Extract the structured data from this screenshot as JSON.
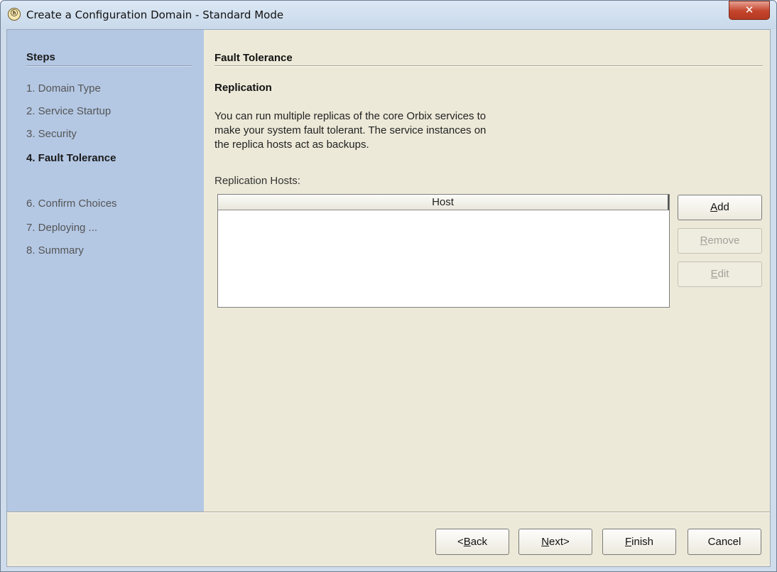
{
  "window": {
    "title": "Create a Configuration Domain - Standard Mode",
    "app_icon_glyph": "ⓗ",
    "close_glyph": "✕"
  },
  "sidebar": {
    "title": "Steps",
    "items": [
      {
        "label": "1. Domain Type",
        "current": false
      },
      {
        "label": "2. Service Startup",
        "current": false
      },
      {
        "label": "3. Security",
        "current": false
      },
      {
        "label": "4. Fault Tolerance",
        "current": true
      },
      {
        "label": "6. Confirm Choices",
        "current": false
      },
      {
        "label": "7. Deploying ...",
        "current": false
      },
      {
        "label": "8. Summary",
        "current": false
      }
    ]
  },
  "main": {
    "section_title": "Fault Tolerance",
    "subsection_title": "Replication",
    "description_lines": [
      "You can run multiple replicas of the core Orbix services to",
      "make your system fault tolerant. The service instances on",
      "the replica hosts act as backups."
    ],
    "hosts_label": "Replication Hosts:",
    "table": {
      "columns": [
        "Host"
      ],
      "rows": []
    },
    "side_buttons": {
      "add": {
        "mnemonic": "A",
        "rest": "dd",
        "enabled": true
      },
      "remove": {
        "mnemonic": "R",
        "rest": "emove",
        "enabled": false
      },
      "edit": {
        "mnemonic": "E",
        "rest": "dit",
        "enabled": false
      }
    }
  },
  "footer": {
    "back": {
      "prefix": "<",
      "mnemonic": "B",
      "rest": "ack"
    },
    "next": {
      "mnemonic": "N",
      "rest": "ext",
      "suffix": ">"
    },
    "finish": {
      "mnemonic": "F",
      "rest": "inish"
    },
    "cancel": {
      "label": "Cancel"
    }
  },
  "colors": {
    "sidebar_bg": "#b4c8e4",
    "content_bg": "#ece9d8",
    "close_button": "#c4432b"
  }
}
